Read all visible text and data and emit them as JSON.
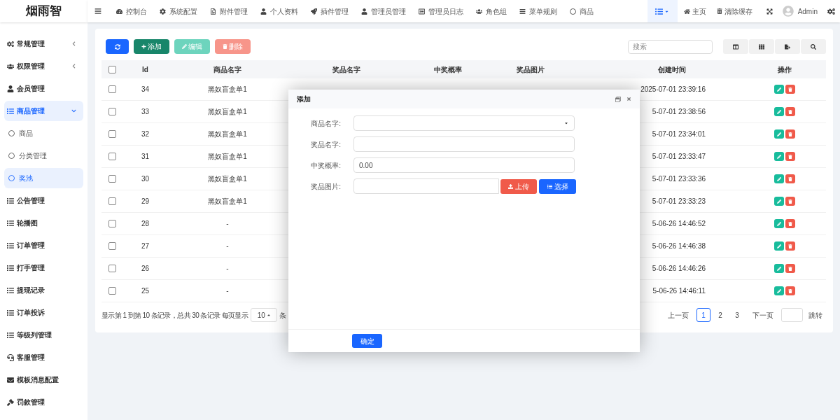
{
  "brand": "烟雨智",
  "top_nav": {
    "items": [
      {
        "label": "控制台"
      },
      {
        "label": "系统配置"
      },
      {
        "label": "附件管理"
      },
      {
        "label": "个人资料"
      },
      {
        "label": "插件管理"
      },
      {
        "label": "管理员管理"
      },
      {
        "label": "管理员日志"
      },
      {
        "label": "角色组"
      },
      {
        "label": "菜单规则"
      },
      {
        "label": "商品"
      }
    ],
    "right": {
      "home": "主页",
      "clear_cache": "清除缓存",
      "user": "Admin"
    }
  },
  "sidebar": {
    "items": [
      {
        "label": "常规管理",
        "selected": false,
        "expanded": false
      },
      {
        "label": "权限管理",
        "selected": false,
        "expanded": false
      },
      {
        "label": "会员管理",
        "selected": false
      },
      {
        "label": "商品管理",
        "selected": true,
        "expanded": true,
        "children": [
          {
            "label": "商品",
            "selected": false
          },
          {
            "label": "分类管理",
            "selected": false
          },
          {
            "label": "奖池",
            "selected": true
          }
        ]
      },
      {
        "label": "公告管理",
        "selected": false
      },
      {
        "label": "轮播图",
        "selected": false
      },
      {
        "label": "订单管理",
        "selected": false
      },
      {
        "label": "打手管理",
        "selected": false
      },
      {
        "label": "提现记录",
        "selected": false
      },
      {
        "label": "订单投诉",
        "selected": false
      },
      {
        "label": "等级列管理",
        "selected": false
      },
      {
        "label": "客服管理",
        "selected": false
      },
      {
        "label": "模板消息配置",
        "selected": false
      },
      {
        "label": "罚款管理",
        "selected": false
      }
    ]
  },
  "toolbar": {
    "add": "添加",
    "edit": "编辑",
    "delete": "删除",
    "edit_disabled": true,
    "delete_disabled": true,
    "search_placeholder": "搜索"
  },
  "table": {
    "columns": [
      "Id",
      "商品名字",
      "奖品名字",
      "中奖概率",
      "奖品图片",
      "创建时间",
      "操作"
    ],
    "header_checked": false,
    "rows": [
      {
        "id": "34",
        "product": "黑奴盲盒单1",
        "created": "2025-07-01 23:39:16",
        "checked": false
      },
      {
        "id": "33",
        "product": "黑奴盲盒单1",
        "created": "5-07-01 23:38:56",
        "checked": false
      },
      {
        "id": "32",
        "product": "黑奴盲盒单1",
        "created": "5-07-01 23:34:01",
        "checked": false
      },
      {
        "id": "31",
        "product": "黑奴盲盒单1",
        "created": "5-07-01 23:33:47",
        "checked": false
      },
      {
        "id": "30",
        "product": "黑奴盲盒单1",
        "created": "5-07-01 23:33:36",
        "checked": false
      },
      {
        "id": "29",
        "product": "黑奴盲盒单1",
        "created": "5-07-01 23:33:23",
        "checked": false
      },
      {
        "id": "28",
        "product": "-",
        "created": "5-06-26 14:46:52",
        "checked": false
      },
      {
        "id": "27",
        "product": "-",
        "created": "5-06-26 14:46:38",
        "checked": false
      },
      {
        "id": "26",
        "product": "-",
        "created": "5-06-26 14:46:26",
        "checked": false
      },
      {
        "id": "25",
        "product": "-",
        "created": "5-06-26 14:46:11",
        "checked": false
      }
    ]
  },
  "pagination": {
    "summary": "显示第 1 到第 10 条记录，总共 30 条记录 每页显示",
    "page_size": "10",
    "suffix": "条",
    "prev": "上一页",
    "pages": [
      {
        "label": "1",
        "selected": true
      },
      {
        "label": "2",
        "selected": false
      },
      {
        "label": "3",
        "selected": false
      }
    ],
    "next": "下一页",
    "jump": "跳转"
  },
  "modal": {
    "title": "添加",
    "fields": [
      {
        "kind": "select",
        "label": "商品名字:"
      },
      {
        "kind": "text",
        "label": "奖品名字:"
      },
      {
        "kind": "text",
        "label": "中奖概率:",
        "value": "0.00"
      },
      {
        "kind": "upload",
        "label": "奖品图片:"
      }
    ],
    "upload": "上传",
    "choose": "选择",
    "confirm": "确定"
  }
}
